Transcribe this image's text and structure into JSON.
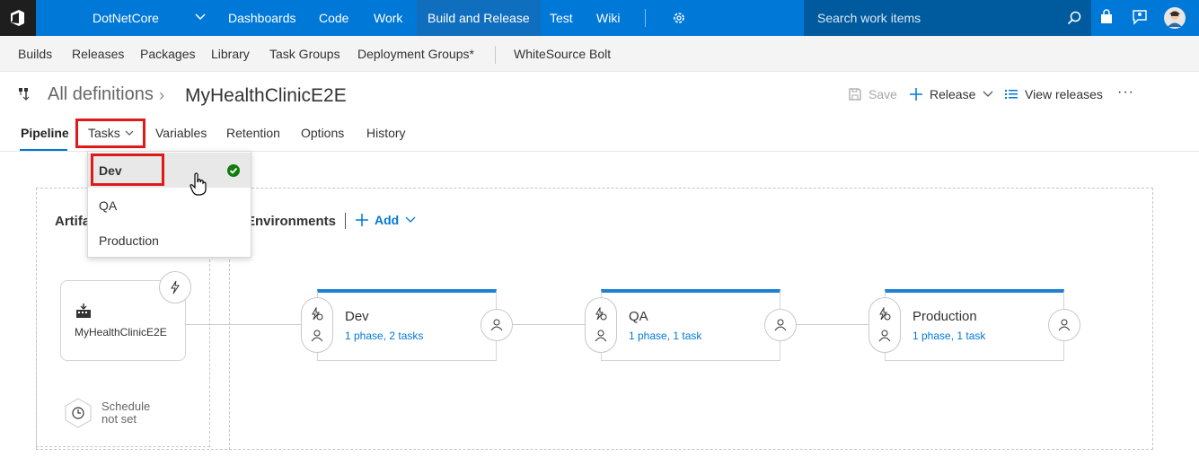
{
  "topbar": {
    "project": "DotNetCore",
    "nav": [
      "Dashboards",
      "Code",
      "Work",
      "Build and Release",
      "Test",
      "Wiki"
    ],
    "active_nav": "Build and Release",
    "search_placeholder": "Search work items"
  },
  "subnav": {
    "items": [
      "Builds",
      "Releases",
      "Packages",
      "Library",
      "Task Groups",
      "Deployment Groups*",
      "WhiteSource Bolt"
    ]
  },
  "header": {
    "breadcrumb_root": "All definitions",
    "separator": "›",
    "definition_name": "MyHealthClinicE2E",
    "commands": {
      "save": "Save",
      "release": "Release",
      "view_releases": "View releases",
      "more": "···"
    }
  },
  "tabs": [
    "Pipeline",
    "Tasks",
    "Variables",
    "Retention",
    "Options",
    "History"
  ],
  "selected_tab": "Pipeline",
  "tasks_dropdown": {
    "items": [
      "Dev",
      "QA",
      "Production"
    ],
    "selected": "Dev"
  },
  "pipeline": {
    "artifacts_label": "Artifa",
    "environments_label": "Environments",
    "add_label": "Add",
    "artifact": {
      "name": "MyHealthClinicE2E"
    },
    "schedule": {
      "line1": "Schedule",
      "line2": "not set"
    },
    "environments": [
      {
        "name": "Dev",
        "summary": "1 phase, 2 tasks"
      },
      {
        "name": "QA",
        "summary": "1 phase, 1 task"
      },
      {
        "name": "Production",
        "summary": "1 phase, 1 task"
      }
    ]
  },
  "colors": {
    "brand_blue": "#0078d7",
    "highlight_red": "#e01a1a",
    "success_green": "#107c10"
  }
}
